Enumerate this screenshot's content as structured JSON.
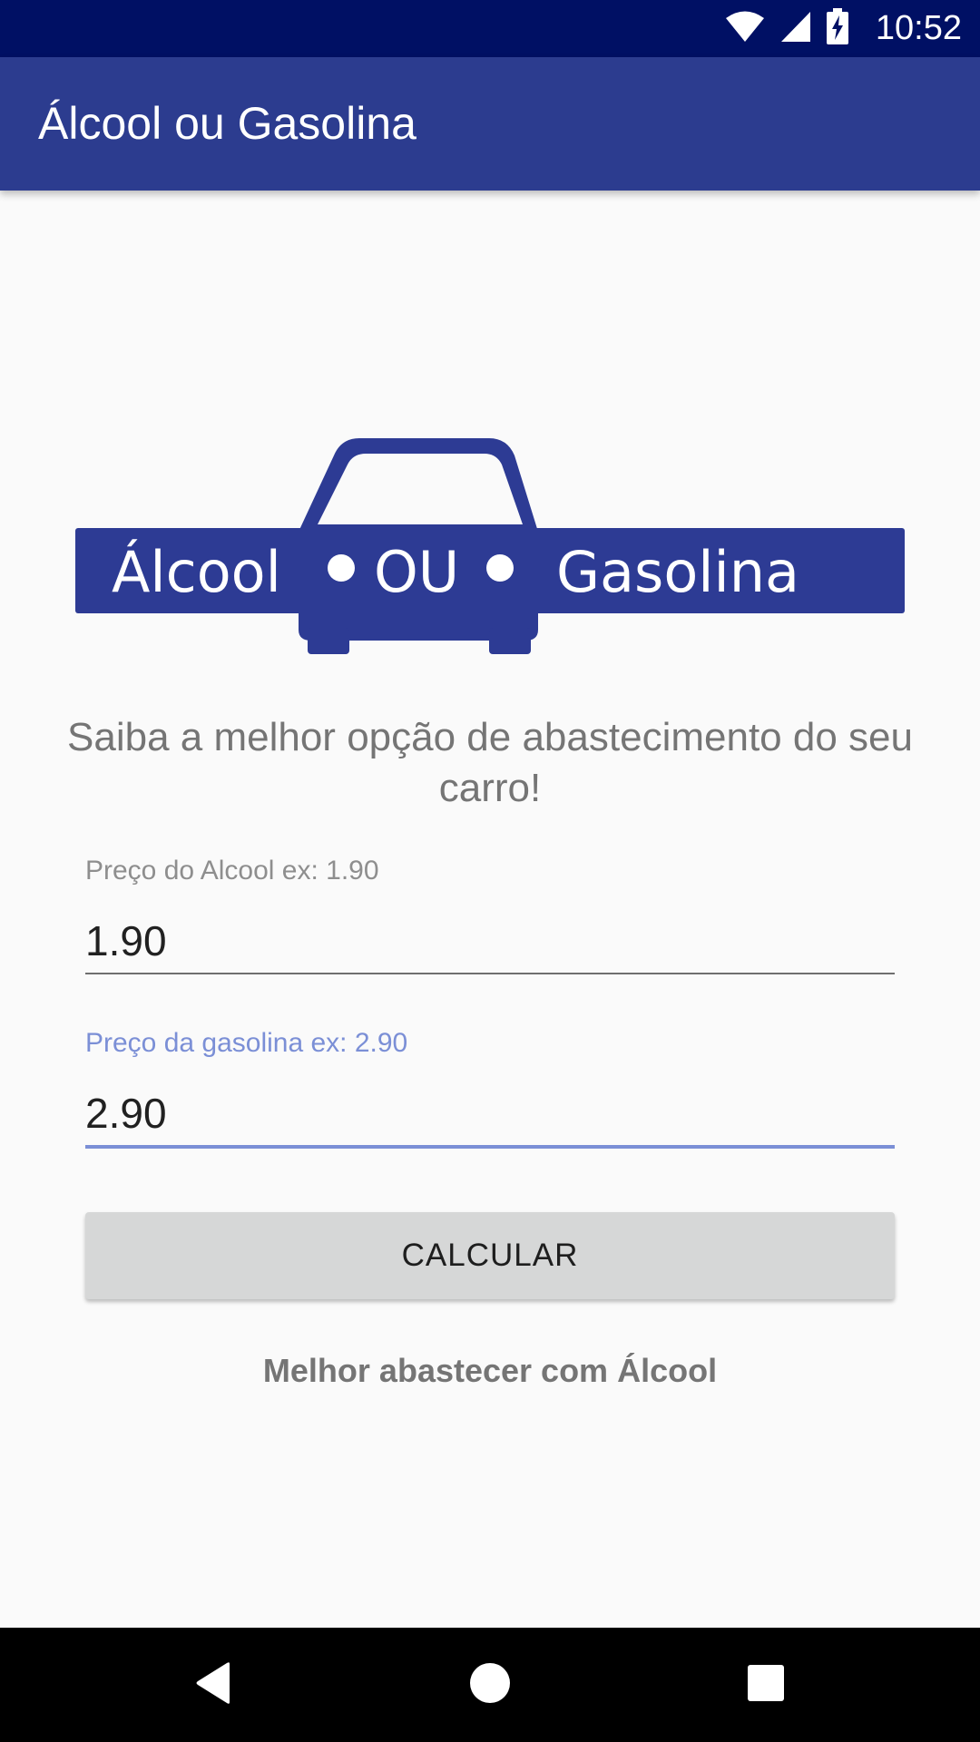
{
  "status_bar": {
    "time": "10:52",
    "icons": [
      "wifi-icon",
      "cell-signal-icon",
      "battery-charging-icon"
    ]
  },
  "app_bar": {
    "title": "Álcool ou Gasolina"
  },
  "logo": {
    "word1": "Álcool",
    "word2": "OU",
    "word3": "Gasolina",
    "color": "#2d3b94"
  },
  "tagline": "Saiba a melhor opção de abastecimento do seu carro!",
  "alcool_field": {
    "label": "Preço do Alcool ex: 1.90",
    "value": "1.90"
  },
  "gasolina_field": {
    "label": "Preço da gasolina ex: 2.90",
    "value": "2.90"
  },
  "calculate_button": {
    "label": "CALCULAR"
  },
  "result_text": "Melhor abastecer com Álcool",
  "nav": {
    "icons": [
      "back-icon",
      "home-icon",
      "recents-icon"
    ]
  },
  "colors": {
    "status_bar": "#001064",
    "app_bar": "#2c3c8f",
    "accent": "#7b8fd6",
    "button": "#d6d7d7"
  }
}
